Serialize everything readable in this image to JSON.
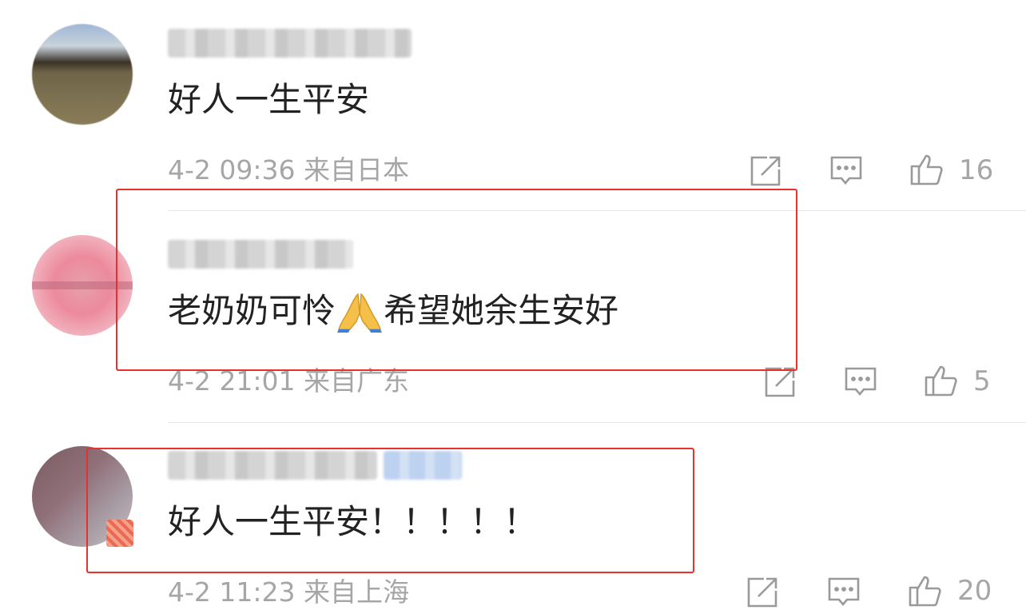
{
  "comments": [
    {
      "text": "好人一生平安",
      "date": "4-2 09:36",
      "location": "来自日本",
      "likes": "16"
    },
    {
      "text_before_emoji": "老奶奶可怜",
      "emoji": "folded-hands",
      "text_after_emoji": "希望她余生安好",
      "date": "4-2 21:01",
      "location": "来自广东",
      "likes": "5"
    },
    {
      "text": "好人一生平安！！！！！",
      "date": "4-2 11:23",
      "location": "来自上海",
      "likes": "20"
    }
  ],
  "icons": {
    "share": "share-icon",
    "reply": "comment-icon",
    "like": "thumbs-up-icon"
  },
  "colors": {
    "highlight": "#e8312f",
    "meta_text": "#a6a6a6",
    "body_text": "#222222"
  }
}
